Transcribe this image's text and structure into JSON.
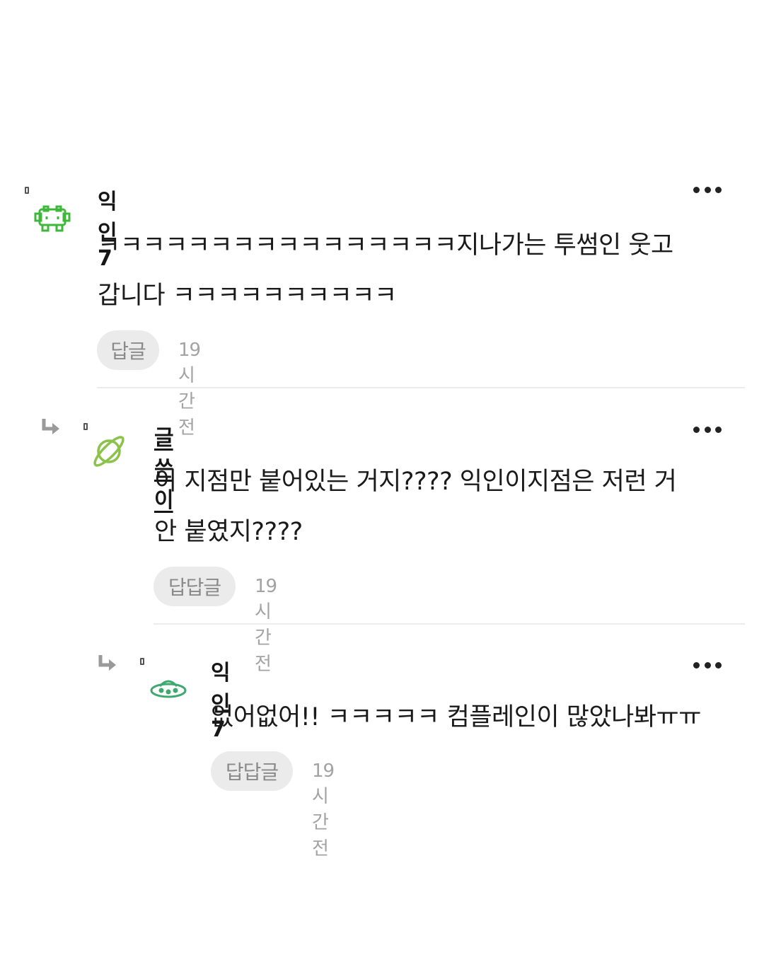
{
  "comments": [
    {
      "author": "익인7",
      "line1": "ㅋㅋㅋㅋㅋㅋㅋㅋㅋㅋㅋㅋㅋㅋㅋㅋ지나가는 투썸인 웃고",
      "line2": "갑니다 ㅋㅋㅋㅋㅋㅋㅋㅋㅋㅋ",
      "reply_label": "답글",
      "time": "19시간 전",
      "avatar_icon": "space-invader-icon"
    },
    {
      "author": "글쓴이",
      "line1": "이 지점만 붙어있는 거지???? 익인이지점은 저런 거",
      "line2": "안 붙였지????",
      "reply_label": "답답글",
      "time": "19시간 전",
      "avatar_icon": "planet-icon"
    },
    {
      "author": "익인7",
      "line1": "없어없어!! ㅋㅋㅋㅋㅋ 컴플레인이 많았나봐ㅠㅠ",
      "reply_label": "답답글",
      "time": "19시간 전",
      "avatar_icon": "ufo-icon"
    }
  ],
  "colors": {
    "avatar_green": "#3db83a",
    "reply_bg": "#ebebeb",
    "meta_gray": "#a3a3a3"
  }
}
